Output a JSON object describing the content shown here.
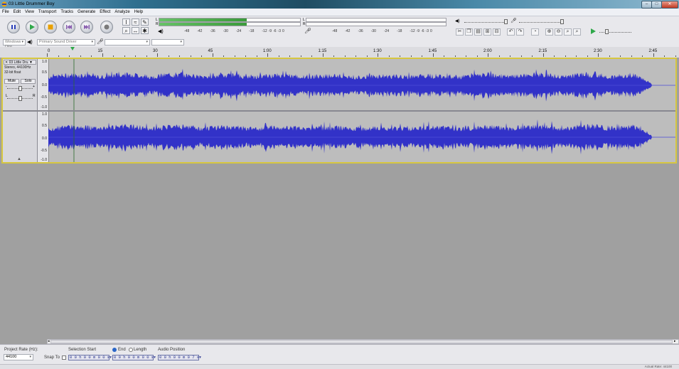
{
  "window": {
    "title": "03 Little Drummer Boy",
    "controls": [
      "–",
      "□",
      "✕"
    ]
  },
  "menu": [
    "File",
    "Edit",
    "View",
    "Transport",
    "Tracks",
    "Generate",
    "Effect",
    "Analyze",
    "Help"
  ],
  "transport": {
    "buttons": [
      "pause",
      "play",
      "stop",
      "skip-start",
      "skip-end",
      "record"
    ]
  },
  "meters": {
    "play_L": "L",
    "play_R": "R",
    "rec_L": "L",
    "rec_R": "R",
    "scale": [
      "-48",
      "-42",
      "-36",
      "-30",
      "-24",
      "-18",
      "-12",
      "-9",
      "-6",
      "-3",
      "0"
    ],
    "playback_level": 0.62
  },
  "device": {
    "host": "Windows Dire",
    "output": "Primary Sound Driver"
  },
  "timeline": {
    "labels": [
      "0",
      "15",
      "30",
      "45",
      "1:00",
      "1:15",
      "1:30",
      "1:45",
      "2:00",
      "2:15",
      "2:30",
      "2:45"
    ]
  },
  "track": {
    "name": "03 Little Dru",
    "info1": "Stereo, 44100Hz",
    "info2": "32-bit float",
    "mute": "Mute",
    "solo": "Solo",
    "gain_minus": "-",
    "gain_plus": "+",
    "pan_l": "L",
    "pan_r": "R",
    "ruler_top": [
      "1.0",
      "0.5",
      "0.0",
      "-0.5",
      "-1.0"
    ],
    "ruler_bottom": [
      "1.0",
      "0.5",
      "0.0",
      "-0.5",
      "-1.0"
    ],
    "wave_color": "#3232c8",
    "sel_color": "#d6c640"
  },
  "selection": {
    "project_rate_label": "Project Rate (Hz):",
    "project_rate": "44100",
    "snap_label": "Snap To",
    "sel_start_label": "Selection Start",
    "end_label": "End",
    "length_label": "Length",
    "audio_pos_label": "Audio Position",
    "sel_start": "0 0 h 0 0 m 0 0 s",
    "sel_end": "0 0 h 0 0 m 0 0 s",
    "audio_pos": "0 0 h 0 0 m 0 7 s"
  },
  "status": {
    "text": "Actual Rate: 44100"
  }
}
